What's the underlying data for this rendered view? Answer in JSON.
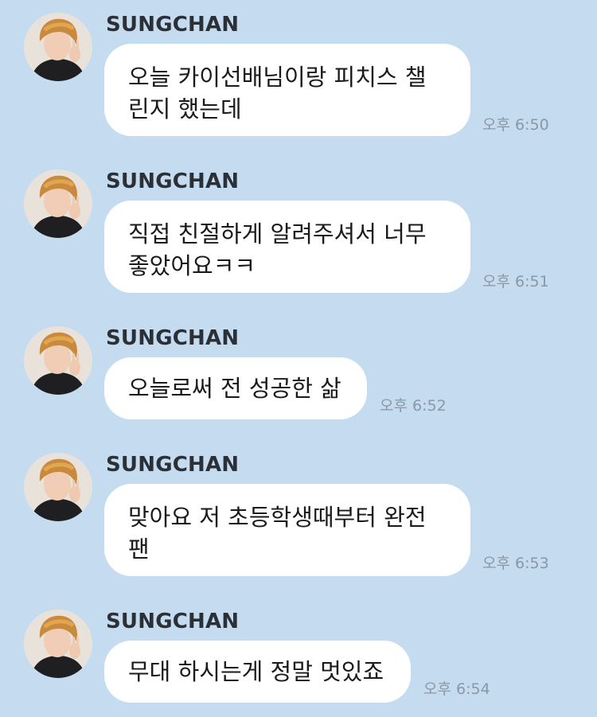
{
  "chat": {
    "messages": [
      {
        "sender": "SUNGCHAN",
        "text": "오늘 카이선배님이랑 피치스 챌\n린지 했는데",
        "time": "오후 6:50"
      },
      {
        "sender": "SUNGCHAN",
        "text": "직접 친절하게 알려주셔서 너무\n좋았어요ㅋㅋ",
        "time": "오후 6:51"
      },
      {
        "sender": "SUNGCHAN",
        "text": "오늘로써 전 성공한 삶",
        "time": "오후 6:52"
      },
      {
        "sender": "SUNGCHAN",
        "text": "맞아요 저 초등학생때부터 완전\n팬",
        "time": "오후 6:53"
      },
      {
        "sender": "SUNGCHAN",
        "text": "무대 하시는게 정말 멋있죠",
        "time": "오후 6:54"
      }
    ]
  },
  "colors": {
    "background": "#c5dcf0",
    "bubble": "#ffffff",
    "sender_text": "#2b2f36",
    "time_text": "#8a97a5"
  },
  "icons": {
    "avatar": "profile-photo"
  }
}
